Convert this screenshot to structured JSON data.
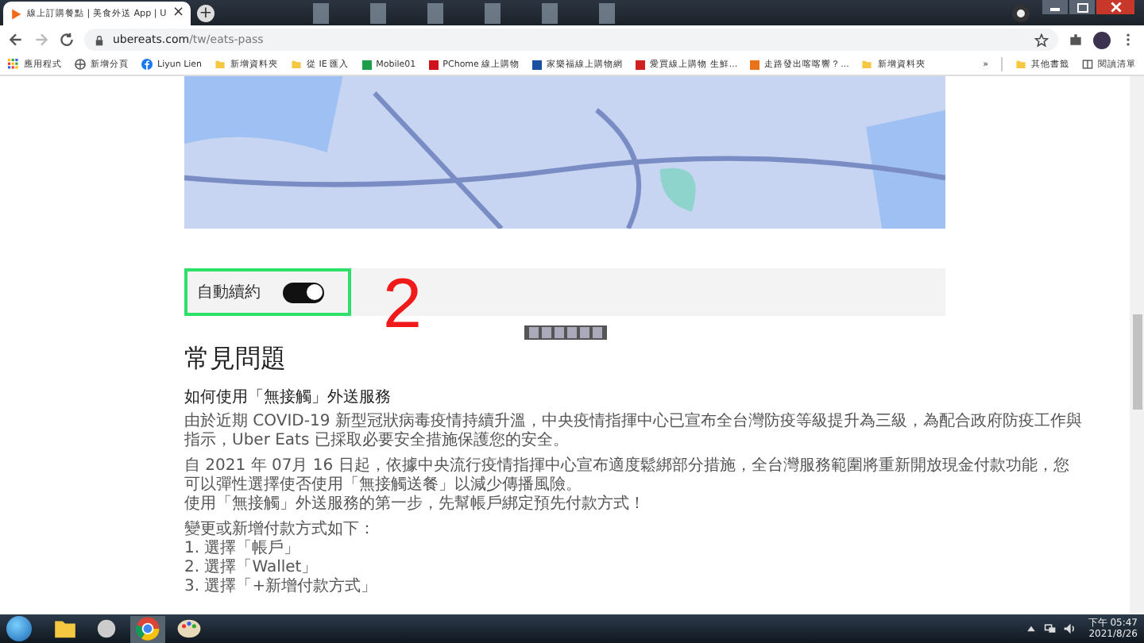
{
  "browser": {
    "tab": {
      "title": "線上訂購餐點 | 美食外送 App | U",
      "close": "×",
      "selected": true
    },
    "new_tab": "+",
    "url": {
      "host": "ubereats.com",
      "path": "/tw/eats-pass"
    },
    "bookmarks": [
      {
        "label": "應用程式",
        "kind": "apps"
      },
      {
        "label": "新增分頁",
        "kind": "globe"
      },
      {
        "label": "Liyun Lien",
        "kind": "facebook"
      },
      {
        "label": "新增資料夾",
        "kind": "folder"
      },
      {
        "label": "從 IE 匯入",
        "kind": "folder"
      },
      {
        "label": "Mobile01",
        "kind": "site",
        "color": "#1e9e4a"
      },
      {
        "label": "PChome 線上購物",
        "kind": "site",
        "color": "#d0121b"
      },
      {
        "label": "家樂福線上購物網",
        "kind": "site",
        "color": "#1b4fa0"
      },
      {
        "label": "愛買線上購物 生鮮...",
        "kind": "site",
        "color": "#d02020"
      },
      {
        "label": "走路發出喀喀響？...",
        "kind": "site",
        "color": "#e8731a"
      },
      {
        "label": "新增資料夾",
        "kind": "folder"
      }
    ],
    "more": "»",
    "other_bookmarks": "其他書籤",
    "reading_list": "閱讀清單"
  },
  "page": {
    "auto_renew": {
      "label": "自動續約",
      "on": true
    },
    "annotation": "2",
    "faq_title": "常見問題",
    "question": "如何使用「無接觸」外送服務",
    "paragraphs": [
      [
        "由於近期 COVID-19 新型冠狀病毒疫情持續升溫，中央疫情指揮中心已宣布全台灣防疫等級提升為三級，為配合政府防疫工作與指示，Uber Eats 已採取必要安全措施保護您的安全。"
      ],
      [
        "自 2021 年 07月 16 日起，依據中央流行疫情指揮中心宣布適度鬆綁部分措施，全台灣服務範圍將重新開放現金付款功能，您可以彈性選擇使否使用「無接觸送餐」以減少傳播風險。",
        "使用「無接觸」外送服務的第一步，先幫帳戶綁定預先付款方式！"
      ],
      [
        "變更或新增付款方式如下：",
        "1. 選擇「帳戶」",
        "2. 選擇「Wallet」",
        "3. 選擇「+新增付款方式」"
      ]
    ]
  },
  "taskbar": {
    "time": "下午 05:47",
    "date": "2021/8/26"
  }
}
